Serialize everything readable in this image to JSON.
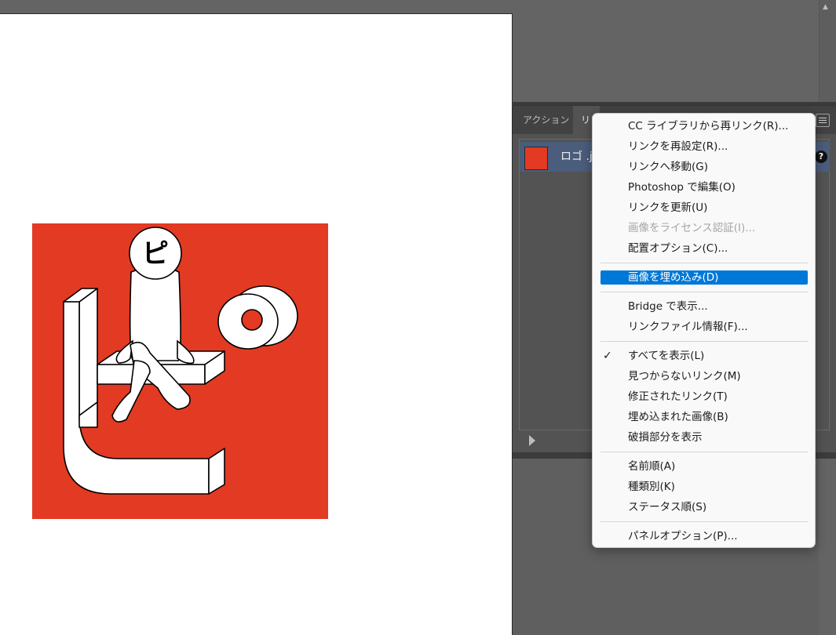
{
  "panel": {
    "tabs": [
      {
        "label": "アクション"
      },
      {
        "label": "リンク"
      }
    ],
    "links": [
      {
        "name": "ロゴ .jpg",
        "status_icon": "?"
      }
    ]
  },
  "menu": {
    "group1": [
      {
        "label": "CC ライブラリから再リンク(R)..."
      },
      {
        "label": "リンクを再設定(R)..."
      },
      {
        "label": "リンクへ移動(G)"
      },
      {
        "label": "Photoshop で編集(O)"
      },
      {
        "label": "リンクを更新(U)"
      },
      {
        "label": "画像をライセンス認証(I)...",
        "disabled": true
      },
      {
        "label": "配置オプション(C)..."
      }
    ],
    "group2": [
      {
        "label": "画像を埋め込み(D)",
        "highlighted": true
      }
    ],
    "group3": [
      {
        "label": "Bridge で表示..."
      },
      {
        "label": "リンクファイル情報(F)..."
      }
    ],
    "group4": [
      {
        "label": "すべてを表示(L)",
        "checked": true
      },
      {
        "label": "見つからないリンク(M)"
      },
      {
        "label": "修正されたリンク(T)"
      },
      {
        "label": "埋め込まれた画像(B)"
      },
      {
        "label": "破損部分を表示"
      }
    ],
    "group5": [
      {
        "label": "名前順(A)"
      },
      {
        "label": "種類別(K)"
      },
      {
        "label": "ステータス順(S)"
      }
    ],
    "group6": [
      {
        "label": "パネルオプション(P)..."
      }
    ]
  },
  "artwork": {
    "logo_char": "ピ",
    "background_color": "#e23a23"
  },
  "colors": {
    "menu_highlight": "#0078d7",
    "selected_row": "#4b5d7c"
  }
}
